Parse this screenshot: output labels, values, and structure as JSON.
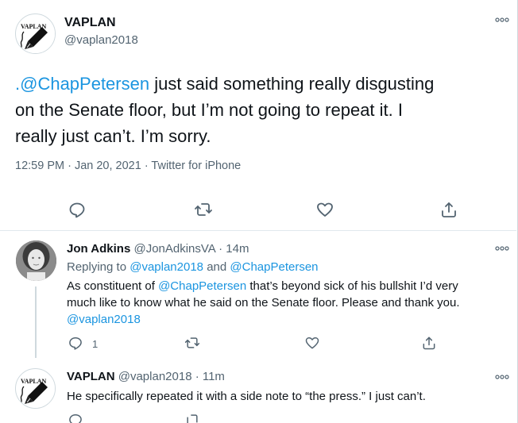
{
  "main_tweet": {
    "avatar_logo_text": "VAPLAN",
    "display_name": "VAPLAN",
    "handle": "@vaplan2018",
    "text_mention": ".@ChapPetersen",
    "text_line1_rest": " just said something really disgusting",
    "text_line2": "on the Senate floor, but I’m not going to repeat it. I",
    "text_line3": "really just can’t. I’m sorry.",
    "meta": "12:59 PM · Jan 20, 2021 · Twitter for iPhone",
    "icons": [
      "reply-icon",
      "retweet-icon",
      "like-icon",
      "share-icon"
    ]
  },
  "reply1": {
    "display_name": "Jon Adkins",
    "handle_time": "@JonAdkinsVA · 14m",
    "replying_prefix": "Replying to ",
    "replying_to_1": "@vaplan2018",
    "replying_and": " and ",
    "replying_to_2": "@ChapPetersen",
    "text_part1": "As constituent of ",
    "text_mention": "@ChapPetersen",
    "text_part2": " that’s beyond sick of his bullshit I’d very",
    "text_line2": "much like to know what he said on the Senate floor. Please and thank you.",
    "text_line3_mention": "@vaplan2018",
    "reply_count": "1"
  },
  "reply2": {
    "avatar_logo_text": "VAPLAN",
    "display_name": "VAPLAN",
    "handle_time": "@vaplan2018 · 11m",
    "text": "He specifically repeated it with a side note to “the press.” I just can’t."
  },
  "colors": {
    "accent": "#1b95e0",
    "secondary_text": "#536471",
    "primary_text": "#0f1419",
    "divider": "#e1e8ed"
  }
}
